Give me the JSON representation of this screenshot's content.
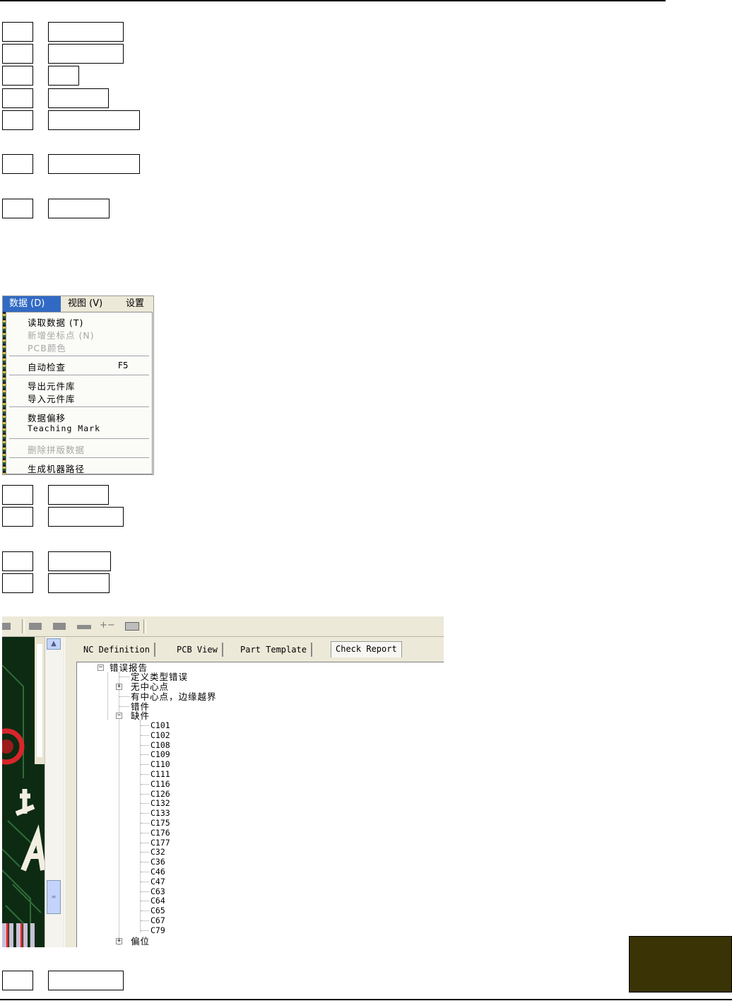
{
  "menu": {
    "bar": [
      {
        "label": "数据 (D)",
        "active": true
      },
      {
        "label": "视图 (V)",
        "active": false
      },
      {
        "label": "设置",
        "active": false
      }
    ],
    "items": [
      {
        "label": "读取数据 (T)",
        "enabled": true
      },
      {
        "label": "新增坐标点 (N)",
        "enabled": false
      },
      {
        "label": "PCB颜色",
        "enabled": false
      },
      {
        "label": "自动检查",
        "shortcut": "F5",
        "enabled": true
      },
      {
        "label": "导出元件库",
        "enabled": true
      },
      {
        "label": "导入元件库",
        "enabled": true
      },
      {
        "label": "数据偏移",
        "enabled": true
      },
      {
        "label": "Teaching Mark",
        "enabled": true
      },
      {
        "label": "删除拼版数据",
        "enabled": false
      },
      {
        "label": "生成机器路径",
        "enabled": true
      }
    ]
  },
  "report": {
    "tabs": [
      "NC Definition",
      "PCB View",
      "Part Template",
      "Check Report"
    ],
    "active_tab": "Check Report",
    "tree": {
      "root": "错误报告",
      "nodes": [
        {
          "label": "定义类型错误",
          "expander": ""
        },
        {
          "label": "无中心点",
          "expander": "+"
        },
        {
          "label": "有中心点，边缘越界",
          "expander": ""
        },
        {
          "label": "错件",
          "expander": ""
        },
        {
          "label": "缺件",
          "expander": "−"
        }
      ],
      "missing_parts": [
        "C101",
        "C102",
        "C108",
        "C109",
        "C110",
        "C111",
        "C116",
        "C126",
        "C132",
        "C133",
        "C175",
        "C176",
        "C177",
        "C32",
        "C36",
        "C46",
        "C47",
        "C63",
        "C64",
        "C65",
        "C67",
        "C79"
      ],
      "after": {
        "label": "偏位",
        "expander": "+"
      }
    }
  }
}
